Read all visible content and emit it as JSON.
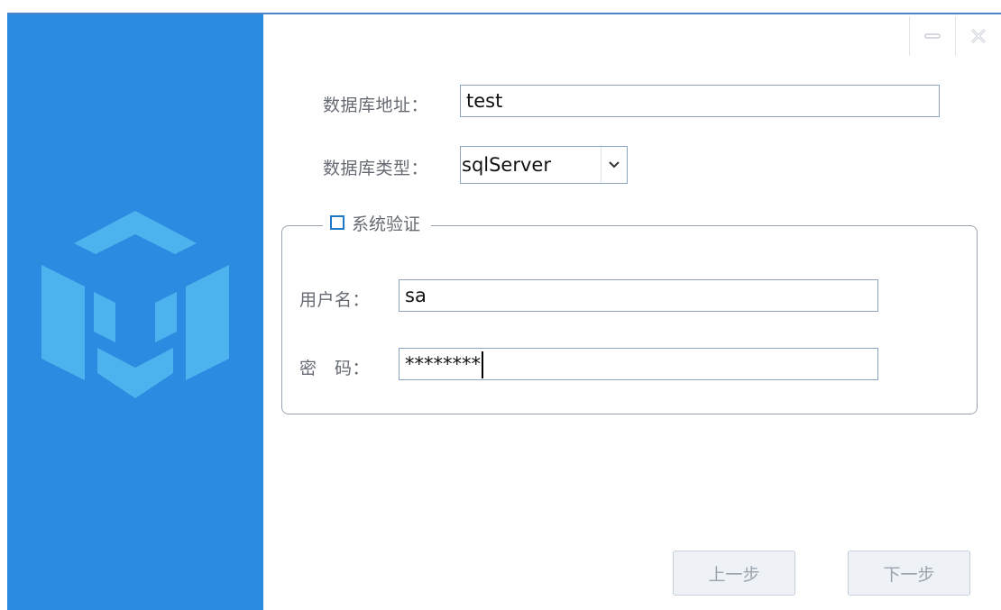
{
  "window": {
    "minimize_icon": "minimize-icon",
    "close_icon": "close-icon"
  },
  "sidebar": {
    "logo_icon": "cube-m-logo",
    "color": "#2b8be0"
  },
  "form": {
    "db_address": {
      "label": "数据库地址：",
      "value": "test"
    },
    "db_type": {
      "label": "数据库类型：",
      "value": "sqlServer"
    },
    "system_auth": {
      "label": "系统验证",
      "checked": false
    },
    "username": {
      "label": "用户名：",
      "value": "sa"
    },
    "password": {
      "label": "密　码：",
      "value": "********"
    }
  },
  "buttons": {
    "prev": "上一步",
    "next": "下一步"
  },
  "colors": {
    "accent": "#2b8be0",
    "logo": "#4db3ef",
    "label": "#666a72"
  }
}
